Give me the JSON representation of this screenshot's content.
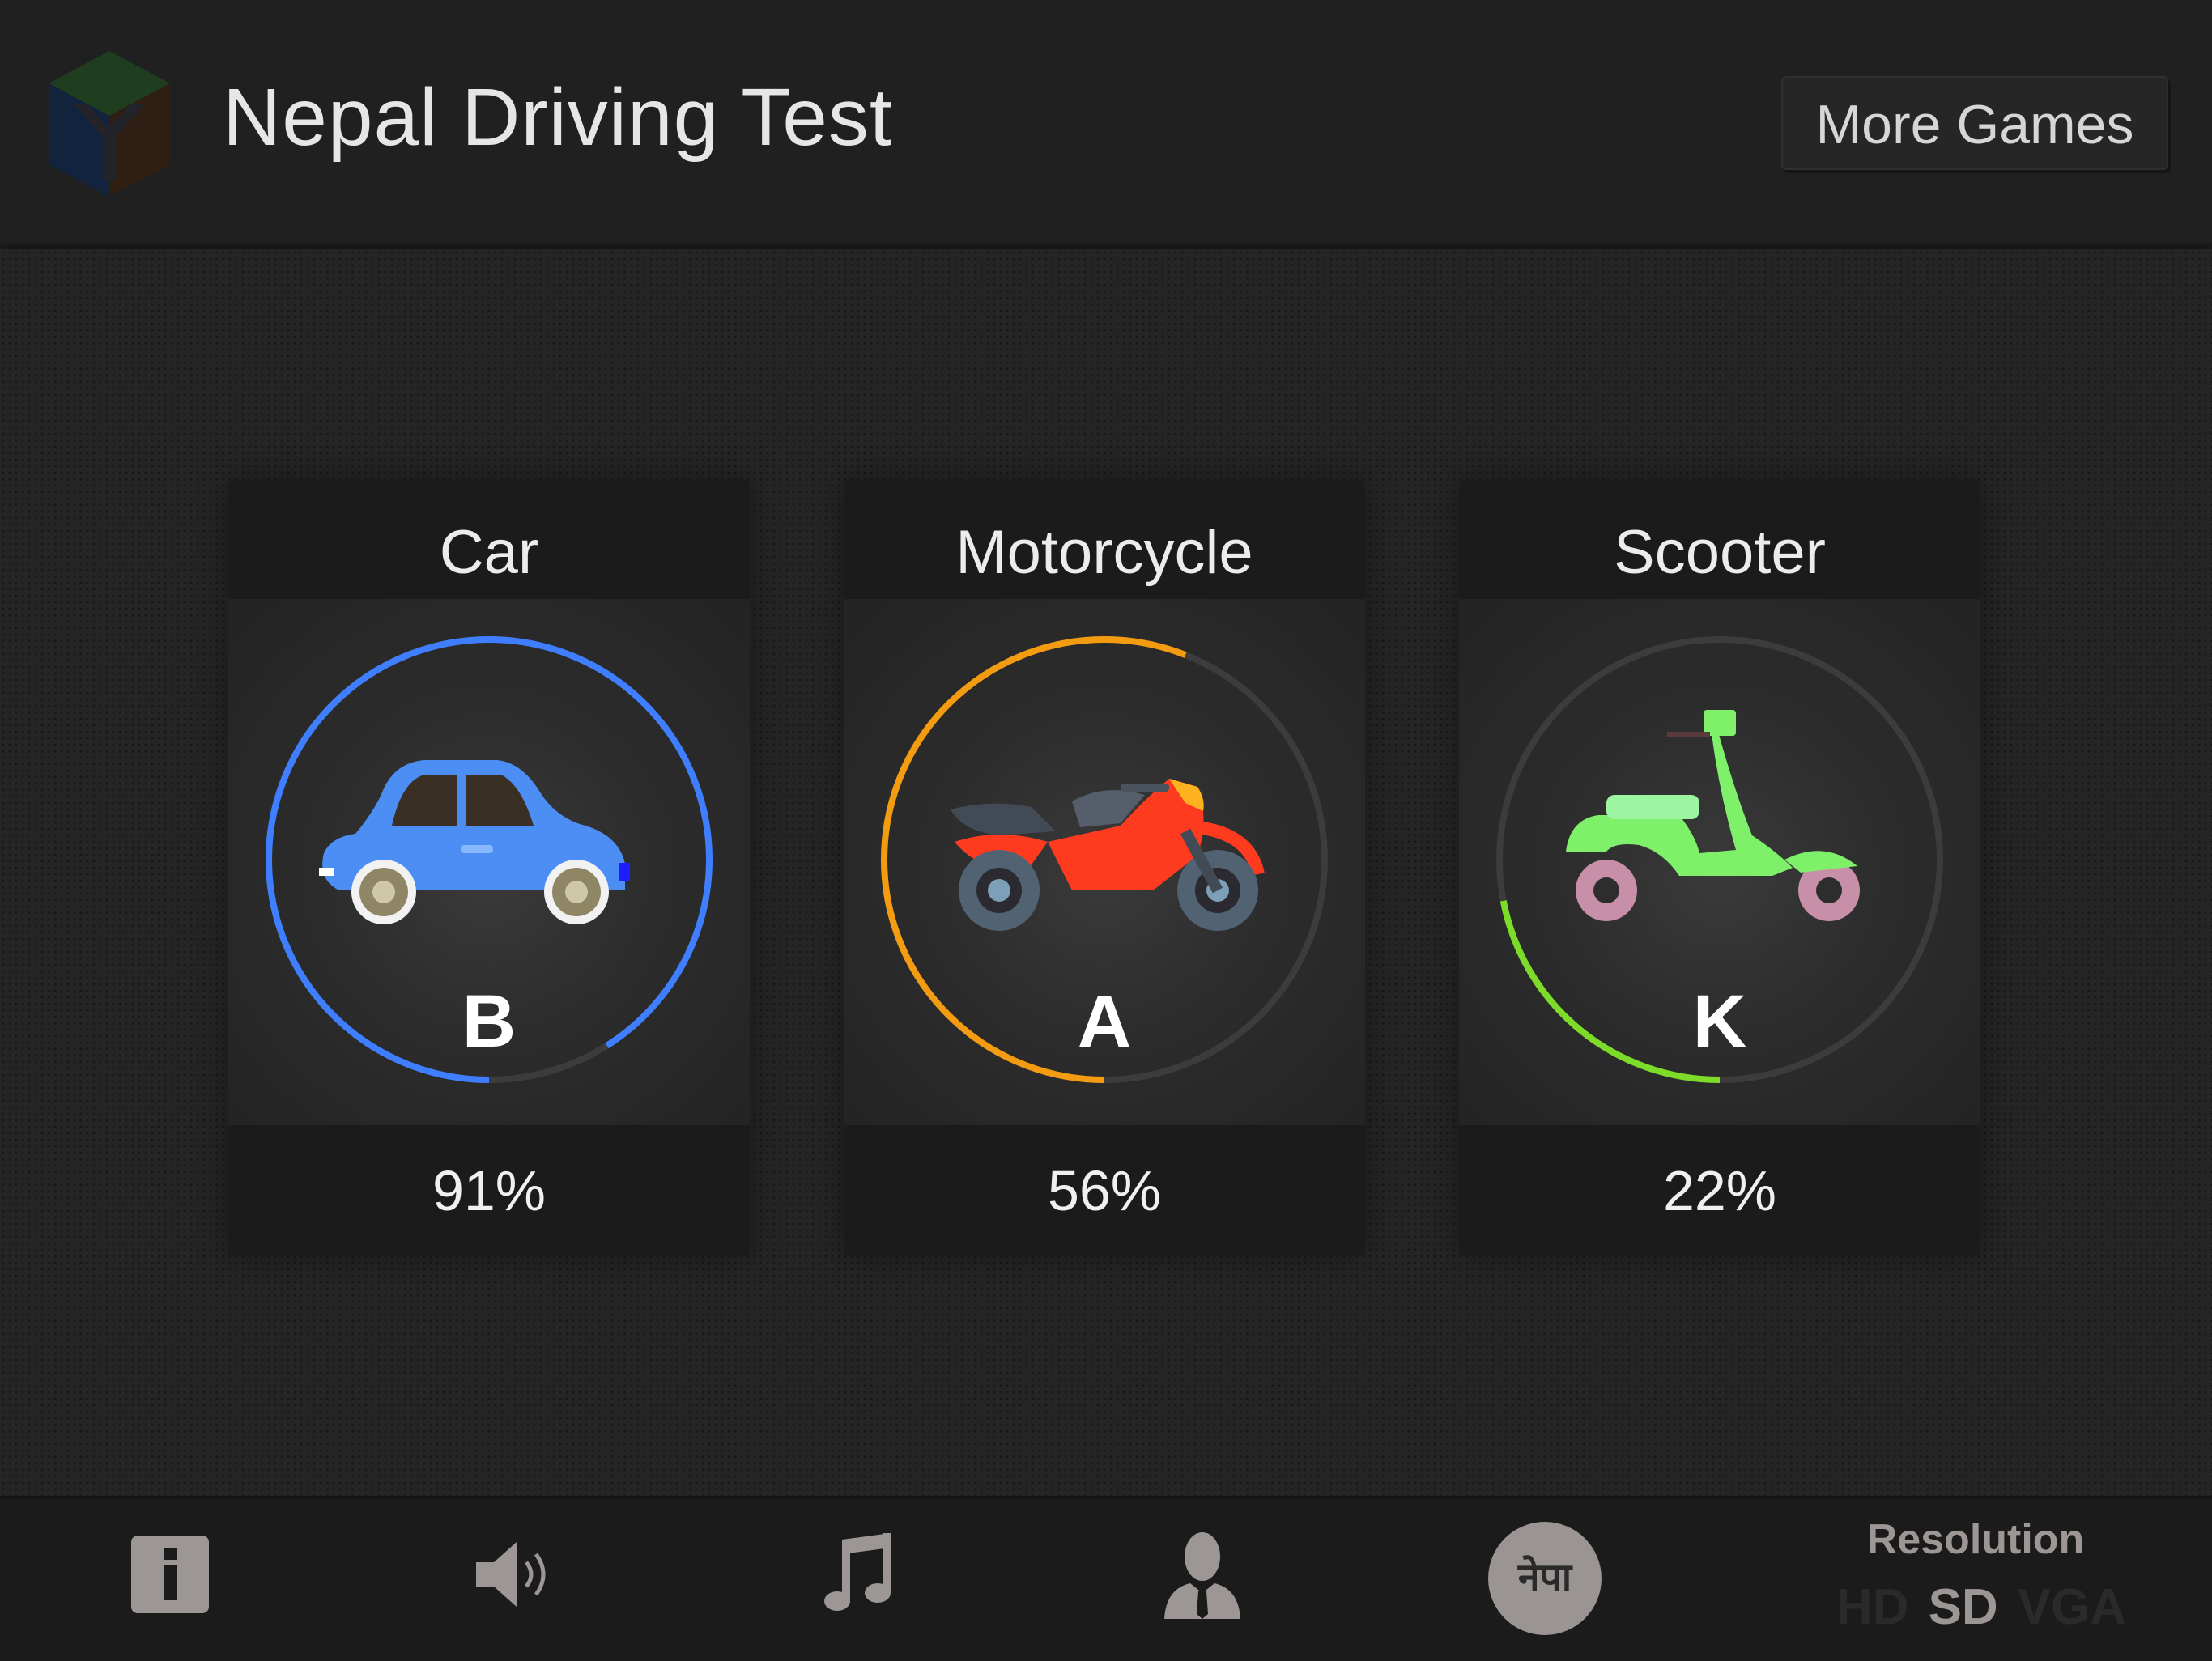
{
  "app": {
    "title": "Nepal Driving Test"
  },
  "header": {
    "more_games_label": "More Games"
  },
  "cards": [
    {
      "title": "Car",
      "grade": "B",
      "percent_label": "91%",
      "progress": 0.91,
      "color": "#3f7fff",
      "icon": "car-icon"
    },
    {
      "title": "Motorcycle",
      "grade": "A",
      "percent_label": "56%",
      "progress": 0.56,
      "color": "#f39c12",
      "icon": "motorcycle-icon"
    },
    {
      "title": "Scooter",
      "grade": "K",
      "percent_label": "22%",
      "progress": 0.22,
      "color": "#7ddc2a",
      "icon": "scooter-icon"
    }
  ],
  "bottombar": {
    "icons": [
      "info-icon",
      "sound-icon",
      "music-icon",
      "profile-icon"
    ],
    "language_label": "नेपा",
    "resolution": {
      "title": "Resolution",
      "options": [
        "HD",
        "SD",
        "VGA"
      ],
      "selected": "SD"
    }
  },
  "colors": {
    "track": "#3c3c3c",
    "text": "#ececec"
  }
}
